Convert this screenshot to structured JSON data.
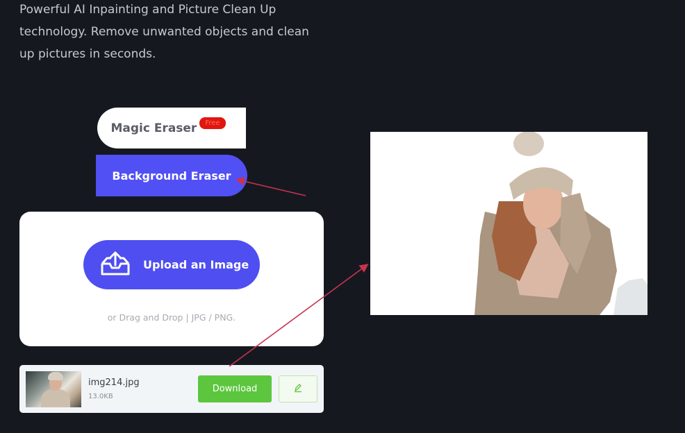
{
  "hero": {
    "description": "Powerful AI Inpainting and Picture Clean Up technology. Remove unwanted objects and clean up pictures in seconds."
  },
  "tabs": {
    "magic_eraser": "Magic Eraser",
    "free_badge": "Free",
    "background_eraser": "Background Eraser"
  },
  "upload": {
    "button_label": "Upload an Image",
    "hint": "or Drag and Drop | JPG / PNG."
  },
  "file": {
    "name": "img214.jpg",
    "size": "13.0KB",
    "download_label": "Download"
  },
  "colors": {
    "background": "#161820",
    "accent": "#5150f5",
    "download_green": "#5cc63e",
    "badge_red": "#e0170f",
    "annotation_arrow": "#c8334f"
  },
  "icons": {
    "upload": "upload-tray-icon",
    "edit": "pen-icon"
  }
}
